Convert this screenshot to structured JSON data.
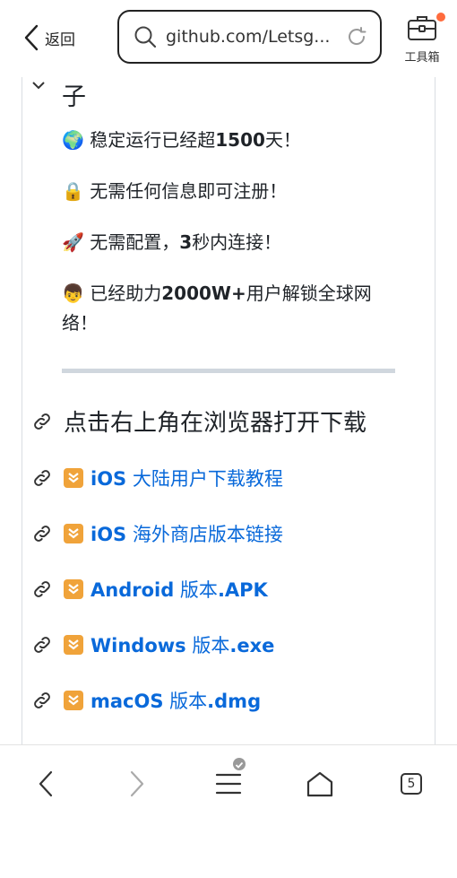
{
  "topbar": {
    "back_label": "返回",
    "url": "github.com/Letsg...",
    "toolbox_label": "工具箱"
  },
  "content": {
    "partial_heading": "子",
    "features": [
      {
        "emoji": "🌍",
        "pre": "稳定运行已经超",
        "bold": "1500",
        "post": "天！"
      },
      {
        "emoji": "🔒",
        "pre": "无需任何信息即可注册！",
        "bold": "",
        "post": ""
      },
      {
        "emoji": "🚀",
        "pre": "无需配置，",
        "bold": "3",
        "post": "秒内连接！"
      },
      {
        "emoji": "👦",
        "pre": "已经助力",
        "bold": "2000W+",
        "post": "用户解锁全球网络！"
      }
    ],
    "section_heading": "点击右上角在浏览器打开下载",
    "links": [
      {
        "bold": "iOS",
        "text": " 大陆用户下载教程",
        "suffix": ""
      },
      {
        "bold": "iOS",
        "text": " 海外商店版本链接",
        "suffix": ""
      },
      {
        "bold": "Android",
        "text": " 版本",
        "suffix": ".APK"
      },
      {
        "bold": "Windows",
        "text": " 版本",
        "suffix": ".exe"
      },
      {
        "bold": "macOS",
        "text": " 版本",
        "suffix": ".dmg"
      }
    ]
  },
  "bottomnav": {
    "tabs_count": "5"
  },
  "colors": {
    "link": "#0969da",
    "badge": "#f0a33a",
    "notification": "#ff6b3d"
  }
}
